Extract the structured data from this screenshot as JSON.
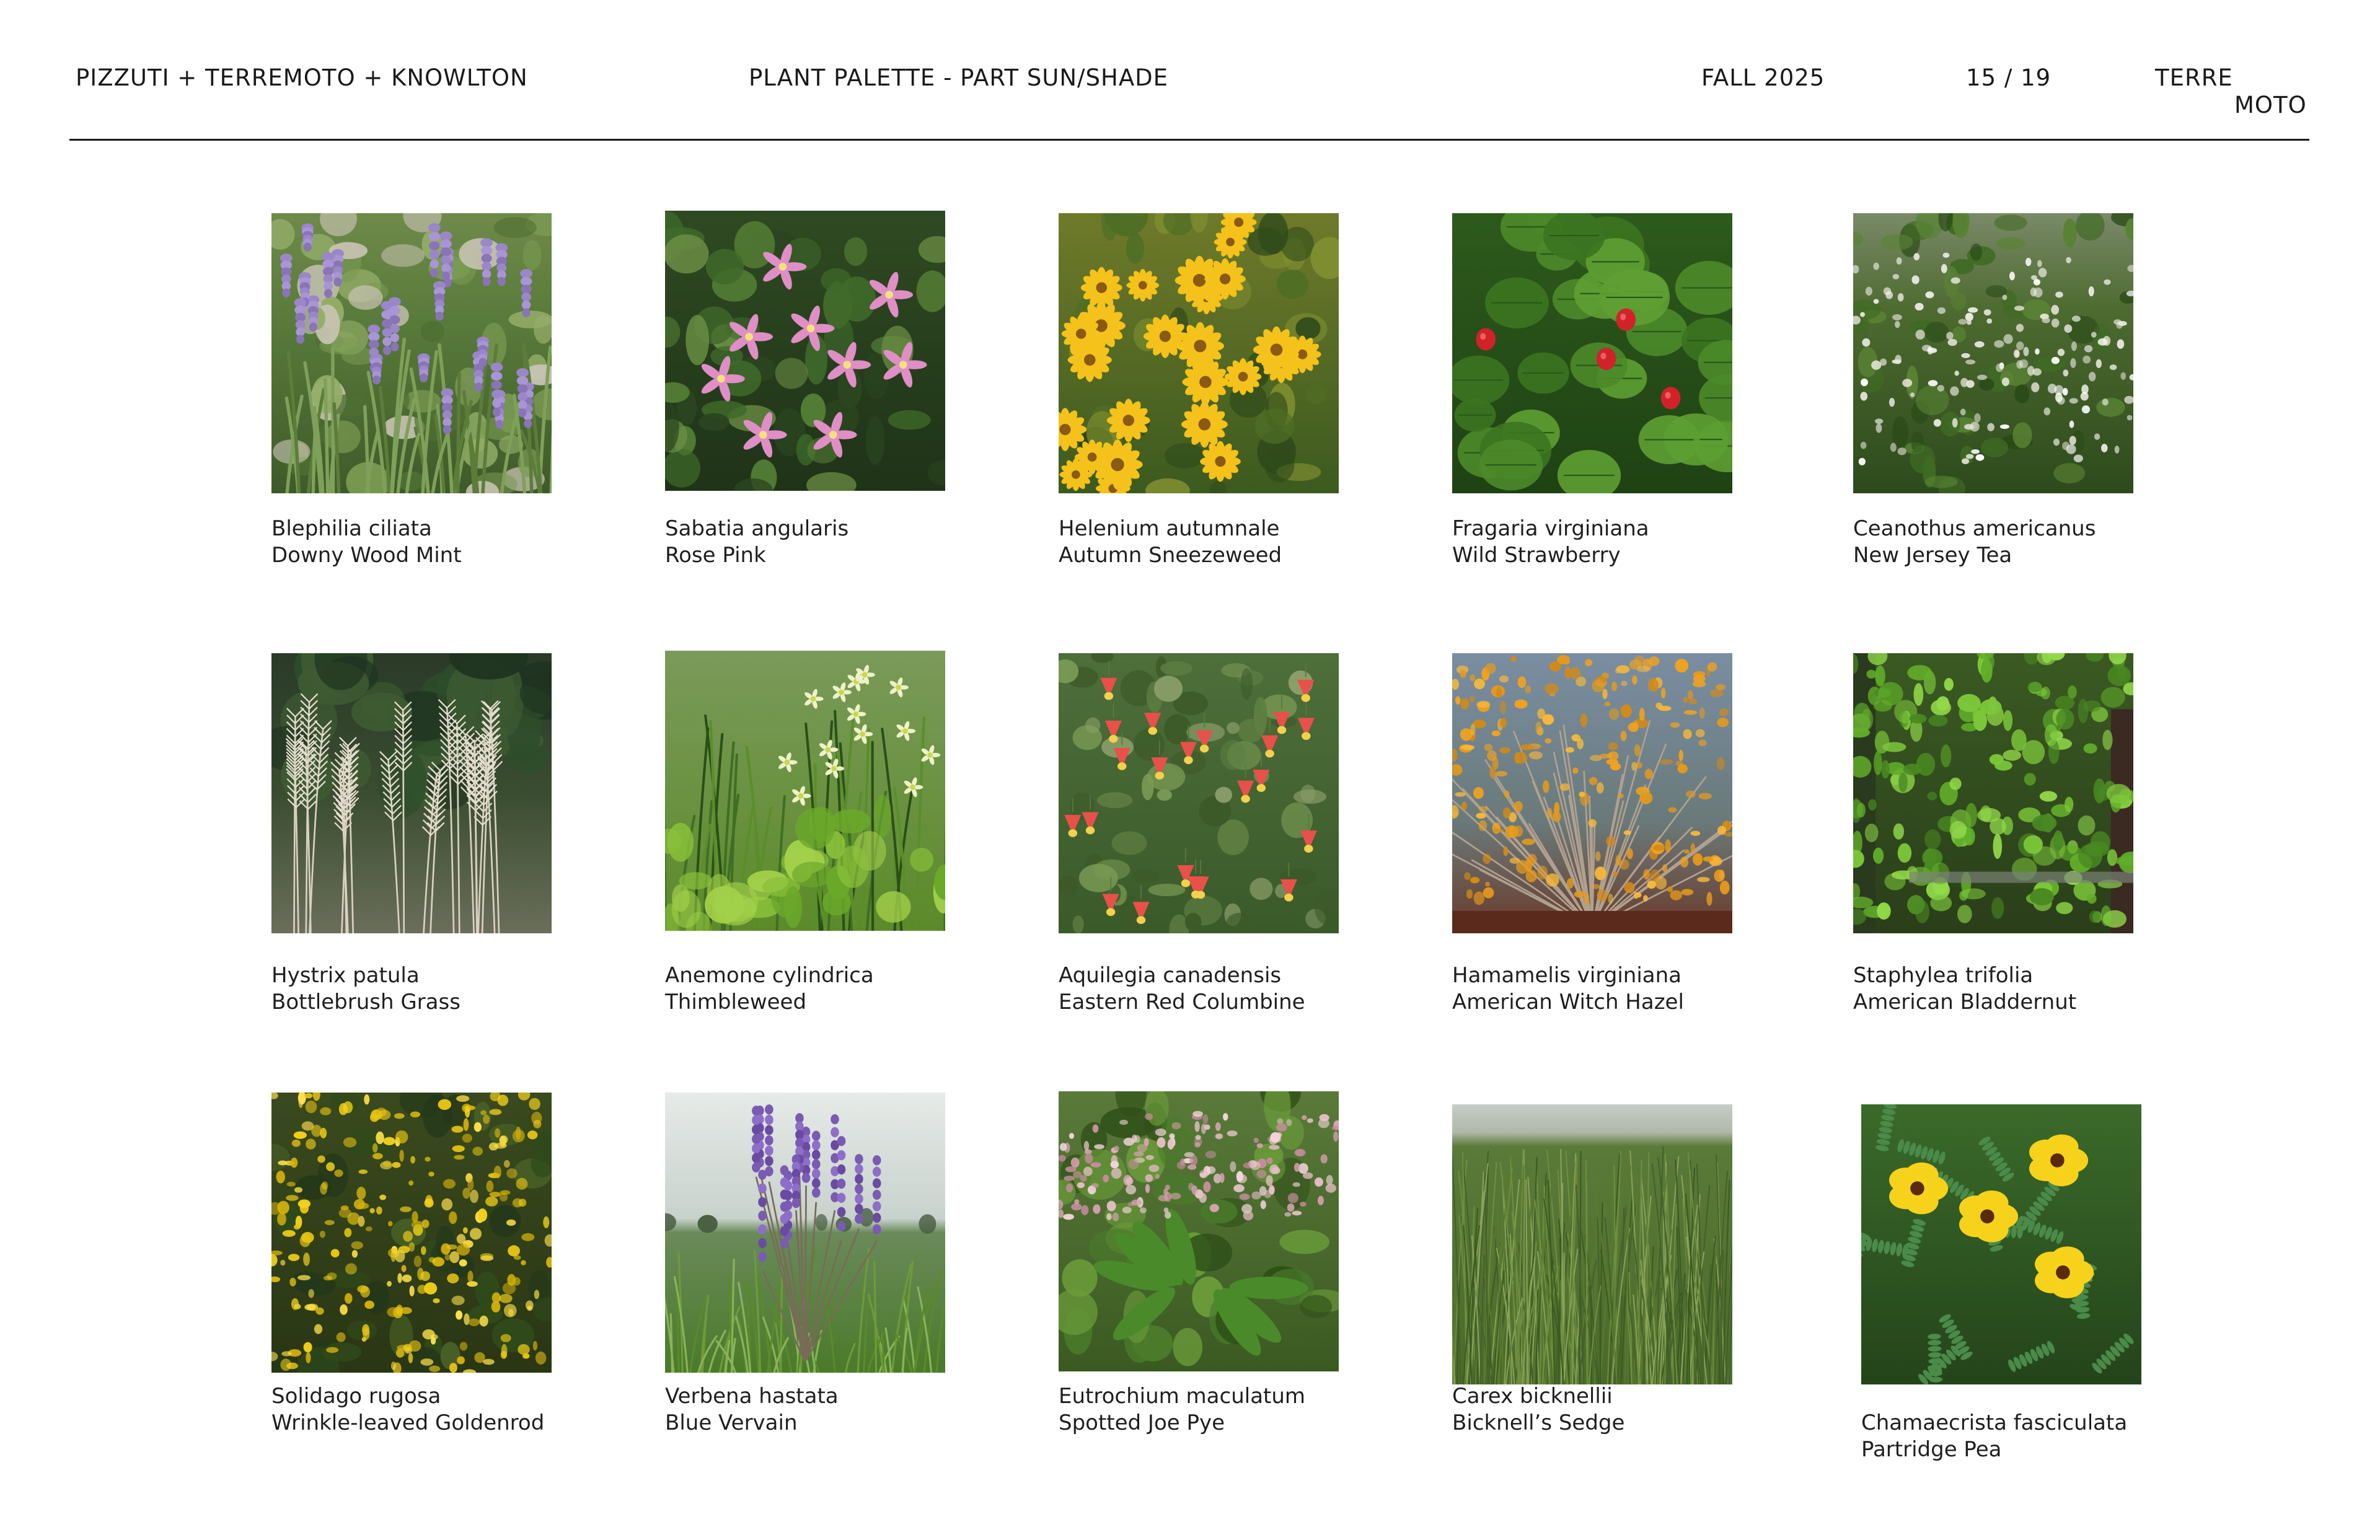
{
  "header": {
    "company": "PIZZUTI + TERREMOTO + KNOWLTON",
    "title": "PLANT PALETTE - PART SUN/SHADE",
    "season": "FALL 2025",
    "page": "15 / 19",
    "logo_line1": "TERRE",
    "logo_line2": "MOTO"
  },
  "plants": [
    {
      "latin": "Blephilia ciliata",
      "common": "Downy Wood Mint",
      "photo": "lavender-spikes"
    },
    {
      "latin": "Sabatia angularis",
      "common": "Rose Pink",
      "photo": "pink-stars"
    },
    {
      "latin": "Helenium autumnale",
      "common": "Autumn Sneezeweed",
      "photo": "yellow-daisies"
    },
    {
      "latin": "Fragaria virginiana",
      "common": "Wild Strawberry",
      "photo": "strawberry"
    },
    {
      "latin": "Ceanothus americanus",
      "common": "New Jersey Tea",
      "photo": "white-clusters"
    },
    {
      "latin": "Hystrix patula",
      "common": "Bottlebrush Grass",
      "photo": "bottlebrush-grass"
    },
    {
      "latin": "Anemone cylindrica",
      "common": "Thimbleweed",
      "photo": "thimbleweed"
    },
    {
      "latin": "Aquilegia canadensis",
      "common": "Eastern Red Columbine",
      "photo": "columbine"
    },
    {
      "latin": "Hamamelis virginiana",
      "common": "American Witch Hazel",
      "photo": "witch-hazel"
    },
    {
      "latin": "Staphylea trifolia",
      "common": "American Bladdernut",
      "photo": "bladdernut"
    },
    {
      "latin": "Solidago rugosa",
      "common": "Wrinkle-leaved Goldenrod",
      "photo": "goldenrod"
    },
    {
      "latin": "Verbena hastata",
      "common": "Blue Vervain",
      "photo": "vervain"
    },
    {
      "latin": "Eutrochium maculatum",
      "common": "Spotted Joe Pye",
      "photo": "joe-pye"
    },
    {
      "latin": "Carex bicknellii",
      "common": "Bicknell’s Sedge",
      "photo": "sedge"
    },
    {
      "latin": "Chamaecrista fasciculata",
      "common": "Partridge Pea",
      "photo": "partridge-pea"
    }
  ]
}
